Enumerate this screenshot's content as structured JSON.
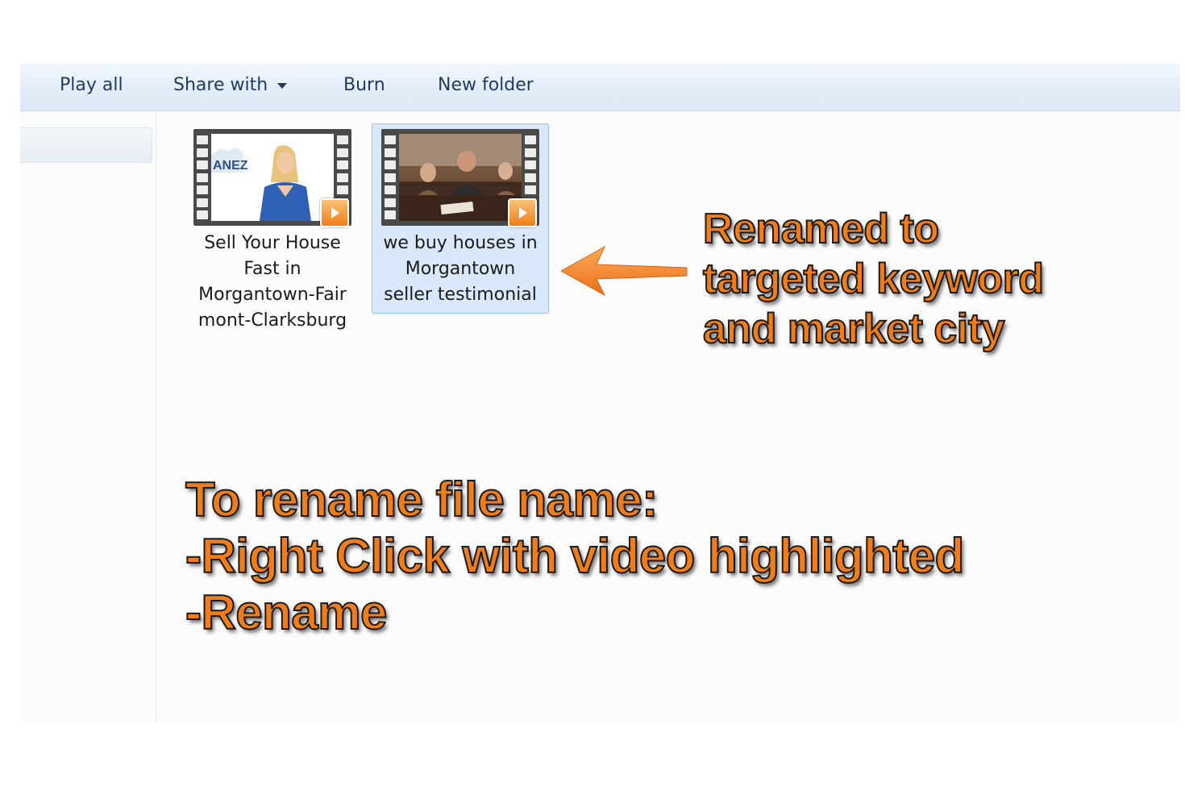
{
  "toolbar": {
    "play_all": "Play all",
    "share_with": "Share with",
    "burn": "Burn",
    "new_folder": "New folder"
  },
  "files": [
    {
      "name": "Sell Your House Fast in Morgantown-Fairmont-Clarksburg",
      "name_lines": [
        "Sell Your House",
        "Fast in",
        "Morgantown-Fair",
        "mont-Clarksburg"
      ],
      "thumbnail_logo": "ANEZ",
      "selected": false,
      "icon": "video-play-icon"
    },
    {
      "name": "we buy houses in Morgantown seller testimonial",
      "name_lines": [
        "we buy houses in",
        "Morgantown",
        "seller testimonial"
      ],
      "selected": true,
      "icon": "video-play-icon"
    }
  ],
  "annotations": {
    "renamed": [
      "Renamed to",
      "targeted keyword",
      "and market city"
    ],
    "instructions": [
      "To rename file name:",
      "-Right Click with video highlighted",
      "-Rename"
    ]
  },
  "colors": {
    "annotation_orange": "#f07d1a",
    "selection_blue": "#d9e8fa",
    "toolbar_text": "#1e3a5f"
  }
}
